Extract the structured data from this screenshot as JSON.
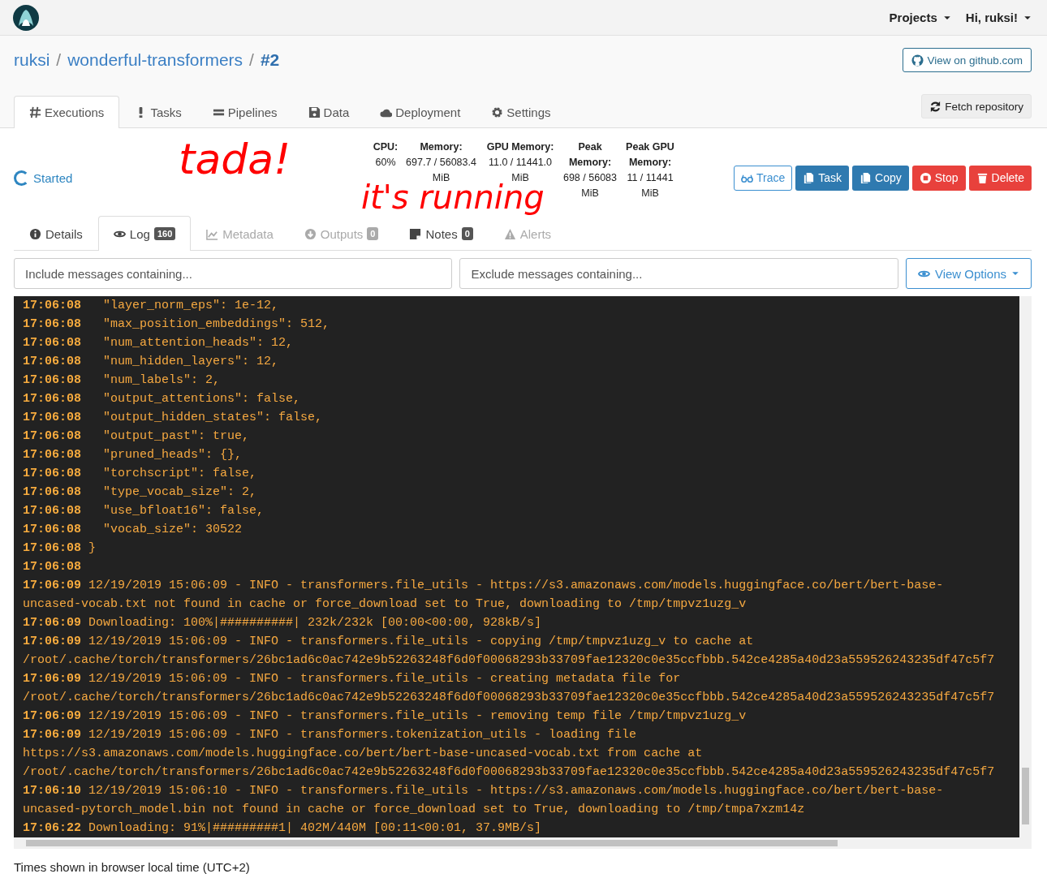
{
  "navbar": {
    "menus": [
      {
        "label": "Projects"
      },
      {
        "label": "Hi, ruksi!"
      }
    ]
  },
  "breadcrumb": [
    {
      "label": "ruksi",
      "current": false
    },
    {
      "label": "wonderful-transformers",
      "current": false
    },
    {
      "label": "#2",
      "current": true
    }
  ],
  "separator": "/",
  "github_button": {
    "label": "View on github.com"
  },
  "tabs": [
    {
      "label": "Executions",
      "selected": true
    },
    {
      "label": "Tasks",
      "selected": false
    },
    {
      "label": "Pipelines",
      "selected": false
    },
    {
      "label": "Data",
      "selected": false
    },
    {
      "label": "Deployment",
      "selected": false
    },
    {
      "label": "Settings",
      "selected": false
    }
  ],
  "fetch_button": {
    "label": "Fetch repository"
  },
  "status": {
    "label": "Started"
  },
  "annotations": [
    {
      "text": "tada!"
    },
    {
      "text": "it's running"
    }
  ],
  "stats": [
    {
      "label": "CPU:",
      "value": "60%"
    },
    {
      "label": "Memory:",
      "value": "697.7 / 56083.4 MiB"
    },
    {
      "label": "GPU Memory:",
      "value": "11.0 / 11441.0 MiB"
    },
    {
      "label": "Peak Memory:",
      "value": "698 / 56083 MiB"
    },
    {
      "label": "Peak GPU Memory:",
      "value": "11 / 11441 MiB"
    }
  ],
  "actions": [
    {
      "label": "Trace",
      "kind": "outline"
    },
    {
      "label": "Task",
      "kind": "primary"
    },
    {
      "label": "Copy",
      "kind": "primary"
    },
    {
      "label": "Stop",
      "kind": "danger"
    },
    {
      "label": "Delete",
      "kind": "danger"
    }
  ],
  "subtabs": [
    {
      "label": "Details",
      "selected": false,
      "disabled": false
    },
    {
      "label": "Log",
      "badge": "160",
      "selected": true,
      "disabled": false
    },
    {
      "label": "Metadata",
      "selected": false,
      "disabled": true
    },
    {
      "label": "Outputs",
      "badge": "0",
      "selected": false,
      "disabled": true
    },
    {
      "label": "Notes",
      "badge": "0",
      "selected": false,
      "disabled": false
    },
    {
      "label": "Alerts",
      "selected": false,
      "disabled": true
    }
  ],
  "filters": [
    {
      "placeholder": "Include messages containing..."
    },
    {
      "placeholder": "Exclude messages containing..."
    }
  ],
  "view_options": {
    "label": "View Options"
  },
  "log": [
    {
      "time": "17:06:08",
      "text": "  \"layer_norm_eps\": 1e-12,"
    },
    {
      "time": "17:06:08",
      "text": "  \"max_position_embeddings\": 512,"
    },
    {
      "time": "17:06:08",
      "text": "  \"num_attention_heads\": 12,"
    },
    {
      "time": "17:06:08",
      "text": "  \"num_hidden_layers\": 12,"
    },
    {
      "time": "17:06:08",
      "text": "  \"num_labels\": 2,"
    },
    {
      "time": "17:06:08",
      "text": "  \"output_attentions\": false,"
    },
    {
      "time": "17:06:08",
      "text": "  \"output_hidden_states\": false,"
    },
    {
      "time": "17:06:08",
      "text": "  \"output_past\": true,"
    },
    {
      "time": "17:06:08",
      "text": "  \"pruned_heads\": {},"
    },
    {
      "time": "17:06:08",
      "text": "  \"torchscript\": false,"
    },
    {
      "time": "17:06:08",
      "text": "  \"type_vocab_size\": 2,"
    },
    {
      "time": "17:06:08",
      "text": "  \"use_bfloat16\": false,"
    },
    {
      "time": "17:06:08",
      "text": "  \"vocab_size\": 30522"
    },
    {
      "time": "17:06:08",
      "text": "}"
    },
    {
      "time": "17:06:08"
    },
    {
      "time": "17:06:09",
      "text": "12/19/2019 15:06:09 - INFO - transformers.file_utils - https://s3.amazonaws.com/models.huggingface.co/bert/bert-base-"
    },
    {
      "text": "uncased-vocab.txt not found in cache or force_download set to True, downloading to /tmp/tmpvz1uzg_v"
    },
    {
      "time": "17:06:09",
      "text": "Downloading: 100%|##########| 232k/232k [00:00<00:00, 928kB/s]"
    },
    {
      "time": "17:06:09",
      "text": "12/19/2019 15:06:09 - INFO - transformers.file_utils - copying /tmp/tmpvz1uzg_v to cache at"
    },
    {
      "text": "/root/.cache/torch/transformers/26bc1ad6c0ac742e9b52263248f6d0f00068293b33709fae12320c0e35ccfbbb.542ce4285a40d23a559526243235df47c5f7"
    },
    {
      "time": "17:06:09",
      "text": "12/19/2019 15:06:09 - INFO - transformers.file_utils - creating metadata file for"
    },
    {
      "text": "/root/.cache/torch/transformers/26bc1ad6c0ac742e9b52263248f6d0f00068293b33709fae12320c0e35ccfbbb.542ce4285a40d23a559526243235df47c5f7"
    },
    {
      "time": "17:06:09",
      "text": "12/19/2019 15:06:09 - INFO - transformers.file_utils - removing temp file /tmp/tmpvz1uzg_v"
    },
    {
      "time": "17:06:09",
      "text": "12/19/2019 15:06:09 - INFO - transformers.tokenization_utils - loading file"
    },
    {
      "text": "https://s3.amazonaws.com/models.huggingface.co/bert/bert-base-uncased-vocab.txt from cache at"
    },
    {
      "text": "/root/.cache/torch/transformers/26bc1ad6c0ac742e9b52263248f6d0f00068293b33709fae12320c0e35ccfbbb.542ce4285a40d23a559526243235df47c5f7"
    },
    {
      "time": "17:06:10",
      "text": "12/19/2019 15:06:10 - INFO - transformers.file_utils - https://s3.amazonaws.com/models.huggingface.co/bert/bert-base-"
    },
    {
      "text": "uncased-pytorch_model.bin not found in cache or force_download set to True, downloading to /tmp/tmpa7xzm14z"
    },
    {
      "time": "17:06:22",
      "text": "Downloading: 91%|#########1| 402M/440M [00:11<00:01, 37.9MB/s]"
    }
  ],
  "footer": {
    "text": "Times shown in browser local time (UTC+2)"
  }
}
